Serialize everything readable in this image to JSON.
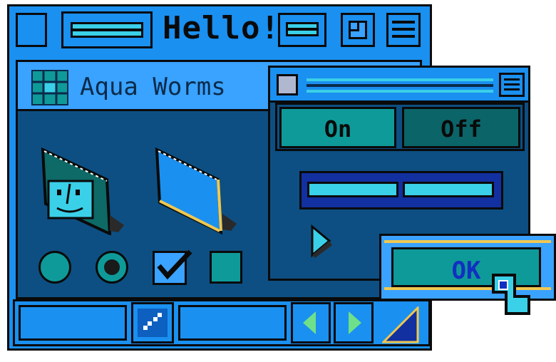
{
  "main_window": {
    "title": "Hello!"
  },
  "inner_window": {
    "title": "Aqua Worms"
  },
  "sub_window": {
    "segment_on": "On",
    "segment_off": "Off",
    "ok_label": "OK"
  },
  "colors": {
    "window_blue": "#1a90f0",
    "panel_dark": "#0d4f82",
    "teal": "#0f9a9a",
    "cyan": "#3ad0e8",
    "ok_text": "#1230c0",
    "accent_yellow": "#f0c850"
  },
  "icons": [
    "close-box-icon",
    "window-shade-icon",
    "zoom-icon",
    "collapse-icon",
    "grid-app-icon",
    "finder-face-icon",
    "folder-icon",
    "play-arrow-icon",
    "resize-corner-icon",
    "scroll-left-icon",
    "scroll-right-icon",
    "scroll-thumb-icon",
    "cursor-pointer-icon",
    "checkbox-icon"
  ]
}
